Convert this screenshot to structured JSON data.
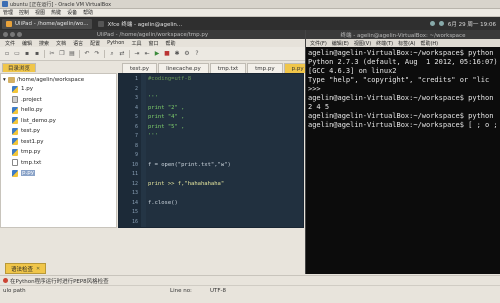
{
  "vbox": {
    "title": "ubuntu [正在运行] - Oracle VM VirtualBox",
    "menu": [
      "管理",
      "控制",
      "视图",
      "热键",
      "设备",
      "帮助"
    ]
  },
  "taskbar": {
    "apps": [
      {
        "label": "UliPad - /home/agelin/wo...",
        "active": true
      },
      {
        "label": "Xfce 终端 - agelin@agelin...",
        "active": false
      }
    ],
    "tray_time": "6月 29 周一 19:06"
  },
  "ulipad": {
    "title": "UliPad - /home/agelin/workspace/tmp.py",
    "menu": [
      "文件",
      "编辑",
      "搜索",
      "文档",
      "语言",
      "配置",
      "Python",
      "工具",
      "窗口",
      "帮助"
    ]
  },
  "left_panel": {
    "tab_label": "目录浏览",
    "root_label": "/home/agelin/workspace",
    "files": [
      {
        "name": "1.py",
        "type": "py"
      },
      {
        "name": ".project",
        "type": "proj"
      },
      {
        "name": "hello.py",
        "type": "py"
      },
      {
        "name": "list_demo.py",
        "type": "py"
      },
      {
        "name": "test.py",
        "type": "py"
      },
      {
        "name": "test1.py",
        "type": "py"
      },
      {
        "name": "tmp.py",
        "type": "py"
      },
      {
        "name": "tmp.txt",
        "type": "txt"
      },
      {
        "name": "p.py",
        "type": "py",
        "selected": true
      }
    ]
  },
  "editor": {
    "tabs": [
      {
        "label": "test.py",
        "selected": false
      },
      {
        "label": "linecache.py",
        "selected": false
      },
      {
        "label": "tmp.txt",
        "selected": false
      },
      {
        "label": "tmp.py",
        "selected": false
      },
      {
        "label": "p.py",
        "selected": true
      }
    ],
    "line_numbers": [
      "1",
      "2",
      "3",
      "4",
      "5",
      "6",
      "7",
      "8",
      "9",
      "10",
      "11",
      "12",
      "13",
      "14",
      "15",
      "16"
    ],
    "lines": [
      {
        "text": "#coding=utf-8",
        "color": "#6a9a5a"
      },
      {
        "text": "",
        "color": "#cfd8e0"
      },
      {
        "text": "'''",
        "color": "#7fd06c"
      },
      {
        "text": "print \"2\" ,",
        "color": "#7fd06c"
      },
      {
        "text": "print \"4\" ,",
        "color": "#7fd06c"
      },
      {
        "text": "print \"5\" ,",
        "color": "#7fd06c"
      },
      {
        "text": "'''",
        "color": "#7fd06c"
      },
      {
        "text": "",
        "color": "#cfd8e0"
      },
      {
        "text": "",
        "color": "#cfd8e0"
      },
      {
        "text": "f = open(\"print.txt\",\"w\")",
        "color": "#cfd8e0"
      },
      {
        "text": "",
        "color": "#cfd8e0"
      },
      {
        "text": "print >> f,\"hahahahaha\"",
        "color": "#e8e8a0"
      },
      {
        "text": "",
        "color": "#cfd8e0"
      },
      {
        "text": "f.close()",
        "color": "#cfd8e0"
      },
      {
        "text": "",
        "color": "#cfd8e0"
      },
      {
        "text": "",
        "color": "#cfd8e0"
      }
    ]
  },
  "bottom_tab": {
    "label": "语法检查"
  },
  "terminal": {
    "title": "终端 - agelin@agelin-VirtualBox: ~/workspace",
    "menu": [
      "文件(F)",
      "编辑(E)",
      "视图(V)",
      "终端(T)",
      "标签(A)",
      "帮助(H)"
    ],
    "lines": [
      "agelin@agelin-VirtualBox:~/workspace$ python",
      "Python 2.7.3 (default, Aug  1 2012, 05:16:07)",
      "[GCC 4.6.3] on linux2",
      "Type \"help\", \"copyright\", \"credits\" or \"lic",
      ">>>",
      "agelin@agelin-VirtualBox:~/workspace$ python",
      "2 4 5",
      "agelin@agelin-VirtualBox:~/workspace$ python",
      "agelin@agelin-VirtualBox:~/workspace$ [ ; o ;"
    ]
  },
  "status": {
    "message": "在Python程序运行时进行PEP8风格检查",
    "path": "ulo path",
    "line_label": "Line no:",
    "encoding": "UTF-8"
  }
}
